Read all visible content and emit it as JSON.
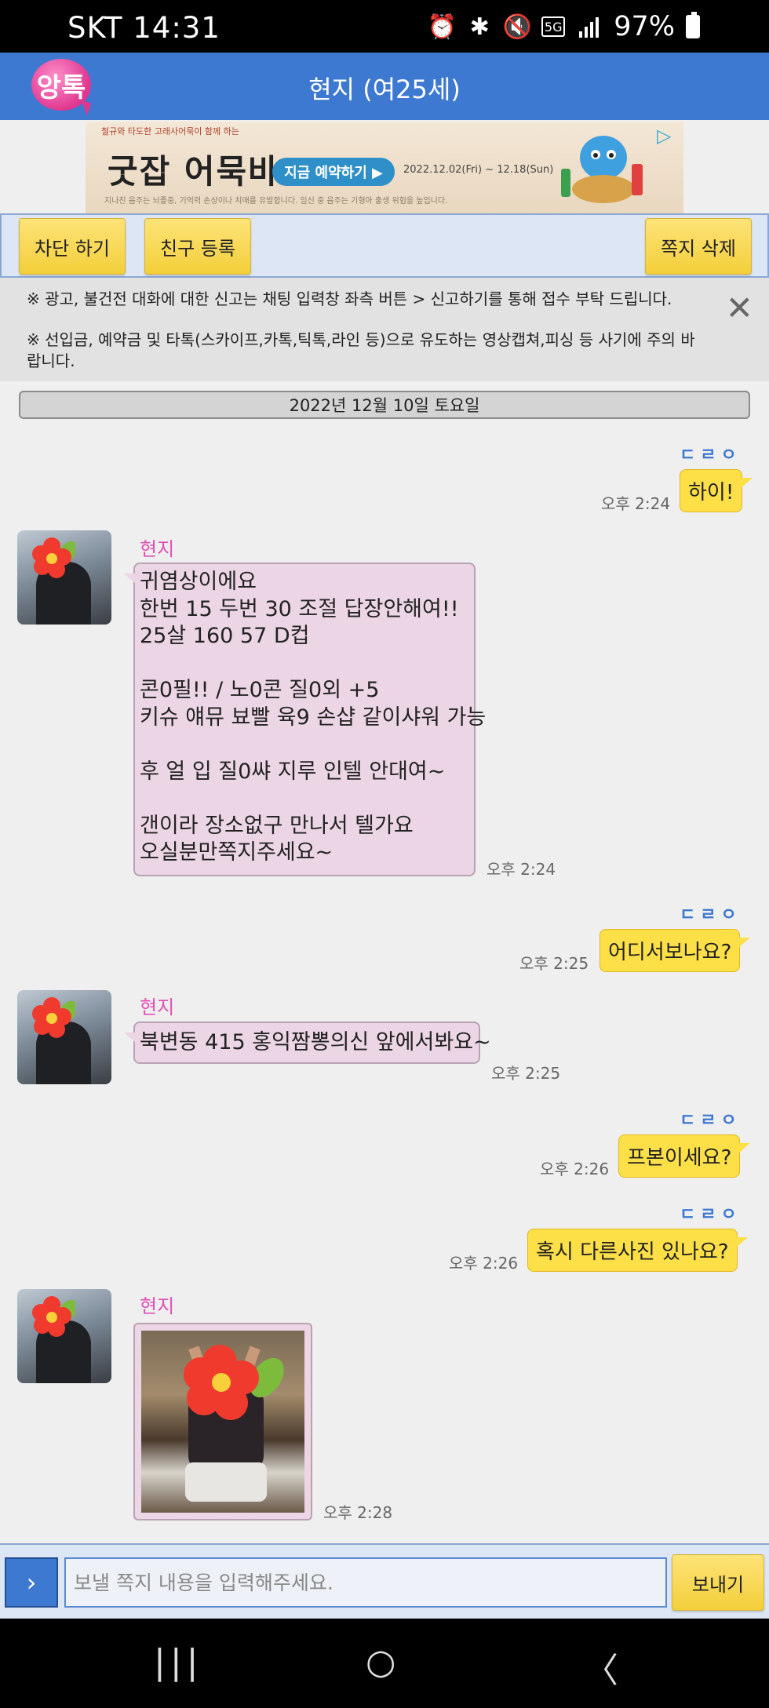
{
  "status_bar": {
    "carrier_time": "SKT 14:31",
    "network": "5G",
    "battery": "97%",
    "icons": [
      "alarm-icon",
      "bluetooth-icon",
      "mute-icon",
      "5g-icon",
      "signal-icon",
      "battery-icon"
    ]
  },
  "header": {
    "logo_text": "앙톡",
    "title": "현지 (여25세)"
  },
  "ad": {
    "top_text": "철규와 타도한 고래사어묵이 함께 하는",
    "title": "굿잡 어묵바",
    "cta": "지금 예약하기 ▶",
    "date": "2022.12.02(Fri) ~ 12.18(Sun)",
    "bottom_text": "지나친 음주는 뇌졸중, 기억력 손상이나 치매를 유발합니다. 임신 중 음주는 기형아 출생 위험을 높입니다."
  },
  "actions": {
    "block": "차단 하기",
    "add_friend": "친구 등록",
    "delete": "쪽지 삭제"
  },
  "notice": {
    "line1": "※ 광고, 불건전 대화에 대한 신고는 채팅 입력창 좌측 버튼 > 신고하기를 통해 접수 부탁 드립니다.",
    "line2a": "※ 선입금, 예약금 및 타톡(스카이프,카톡,틱톡,라인 등)으로 유도하는 영상캡쳐,피싱 등 사기에 주의 바",
    "line2b": "랍니다."
  },
  "date_divider": "2022년 12월 10일 토요일",
  "read_mark": "ㄷㄹㅇ",
  "messages": {
    "out1": {
      "text": "하이!",
      "time": "오후 2:24"
    },
    "in1": {
      "sender": "현지",
      "lines": [
        "귀염상이에요",
        "한번 15 두번 30 조절 답장안해여!!",
        "25살 160 57 D컵",
        "",
        "콘0필!! / 노0콘 질0외 +5",
        "키슈 얘뮤 뵤빨 육9 손샵 같이샤워 가능",
        "",
        "후 얼 입 질0쌰 지루 인텔 안대여~",
        "",
        "갠이라 장소없구 만나서 텔가요",
        "오실분만쪽지주세요~"
      ],
      "time": "오후 2:24"
    },
    "out2": {
      "text": "어디서보나요?",
      "time": "오후 2:25"
    },
    "in2": {
      "sender": "현지",
      "text": "북변동 415 홍익짬뽕의신 앞에서봐요~",
      "time": "오후 2:25"
    },
    "out3": {
      "text": "프본이세요?",
      "time": "오후 2:26"
    },
    "out4": {
      "text": "혹시 다른사진  있나요?",
      "time": "오후 2:26"
    },
    "in3": {
      "sender": "현지",
      "time": "오후 2:28"
    }
  },
  "input": {
    "placeholder": "보낼 쪽지 내용을 입력해주세요.",
    "expand_label": "›",
    "send": "보내기"
  },
  "nav": {
    "recents": "|||",
    "home": "○",
    "back": "〈"
  }
}
